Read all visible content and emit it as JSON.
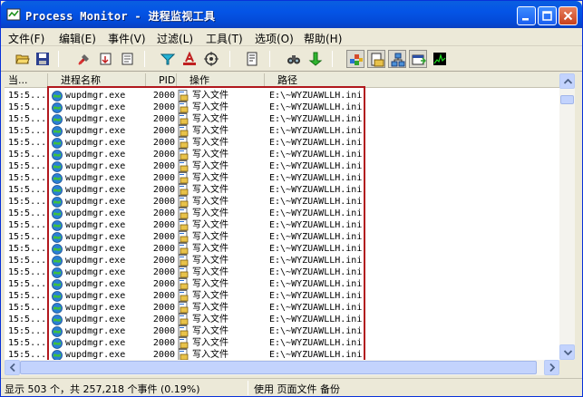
{
  "window": {
    "title": "Process Monitor - 进程监视工具"
  },
  "menu": [
    {
      "label": "文件(F)"
    },
    {
      "label": "编辑(E)"
    },
    {
      "label": "事件(V)"
    },
    {
      "label": "过滤(L)"
    },
    {
      "label": "工具(T)"
    },
    {
      "label": "选项(O)"
    },
    {
      "label": "帮助(H)"
    }
  ],
  "toolbar": [
    {
      "icon": "open-folder-icon"
    },
    {
      "icon": "save-icon"
    },
    {
      "icon": "clear-icon"
    },
    {
      "icon": "autoscroll-icon"
    },
    {
      "icon": "capture-icon"
    },
    {
      "icon": "filter-icon"
    },
    {
      "icon": "highlight-icon"
    },
    {
      "icon": "target-icon"
    },
    {
      "icon": "process-tree-icon"
    },
    {
      "icon": "find-icon"
    },
    {
      "icon": "jump-icon"
    },
    {
      "icon": "registry-icon"
    },
    {
      "icon": "file-system-icon"
    },
    {
      "icon": "network-icon"
    },
    {
      "icon": "process-thread-icon"
    },
    {
      "icon": "profiling-icon"
    }
  ],
  "columns": {
    "time": "当...",
    "process": "进程名称",
    "pid": "PID",
    "operation": "操作",
    "path": "路径"
  },
  "rows": [
    {
      "time": "15:5...",
      "process": "wupdmgr.exe",
      "pid": "2000",
      "operation": "写入文件",
      "path": "E:\\~WYZUAWLLH.ini"
    },
    {
      "time": "15:5...",
      "process": "wupdmgr.exe",
      "pid": "2000",
      "operation": "写入文件",
      "path": "E:\\~WYZUAWLLH.ini"
    },
    {
      "time": "15:5...",
      "process": "wupdmgr.exe",
      "pid": "2000",
      "operation": "写入文件",
      "path": "E:\\~WYZUAWLLH.ini"
    },
    {
      "time": "15:5...",
      "process": "wupdmgr.exe",
      "pid": "2000",
      "operation": "写入文件",
      "path": "E:\\~WYZUAWLLH.ini"
    },
    {
      "time": "15:5...",
      "process": "wupdmgr.exe",
      "pid": "2000",
      "operation": "写入文件",
      "path": "E:\\~WYZUAWLLH.ini"
    },
    {
      "time": "15:5...",
      "process": "wupdmgr.exe",
      "pid": "2000",
      "operation": "写入文件",
      "path": "E:\\~WYZUAWLLH.ini"
    },
    {
      "time": "15:5...",
      "process": "wupdmgr.exe",
      "pid": "2000",
      "operation": "写入文件",
      "path": "E:\\~WYZUAWLLH.ini"
    },
    {
      "time": "15:5...",
      "process": "wupdmgr.exe",
      "pid": "2000",
      "operation": "写入文件",
      "path": "E:\\~WYZUAWLLH.ini"
    },
    {
      "time": "15:5...",
      "process": "wupdmgr.exe",
      "pid": "2000",
      "operation": "写入文件",
      "path": "E:\\~WYZUAWLLH.ini"
    },
    {
      "time": "15:5...",
      "process": "wupdmgr.exe",
      "pid": "2000",
      "operation": "写入文件",
      "path": "E:\\~WYZUAWLLH.ini"
    },
    {
      "time": "15:5...",
      "process": "wupdmgr.exe",
      "pid": "2000",
      "operation": "写入文件",
      "path": "E:\\~WYZUAWLLH.ini"
    },
    {
      "time": "15:5...",
      "process": "wupdmgr.exe",
      "pid": "2000",
      "operation": "写入文件",
      "path": "E:\\~WYZUAWLLH.ini"
    },
    {
      "time": "15:5...",
      "process": "wupdmgr.exe",
      "pid": "2000",
      "operation": "写入文件",
      "path": "E:\\~WYZUAWLLH.ini"
    },
    {
      "time": "15:5...",
      "process": "wupdmgr.exe",
      "pid": "2000",
      "operation": "写入文件",
      "path": "E:\\~WYZUAWLLH.ini"
    },
    {
      "time": "15:5...",
      "process": "wupdmgr.exe",
      "pid": "2000",
      "operation": "写入文件",
      "path": "E:\\~WYZUAWLLH.ini"
    },
    {
      "time": "15:5...",
      "process": "wupdmgr.exe",
      "pid": "2000",
      "operation": "写入文件",
      "path": "E:\\~WYZUAWLLH.ini"
    },
    {
      "time": "15:5...",
      "process": "wupdmgr.exe",
      "pid": "2000",
      "operation": "写入文件",
      "path": "E:\\~WYZUAWLLH.ini"
    },
    {
      "time": "15:5...",
      "process": "wupdmgr.exe",
      "pid": "2000",
      "operation": "写入文件",
      "path": "E:\\~WYZUAWLLH.ini"
    },
    {
      "time": "15:5...",
      "process": "wupdmgr.exe",
      "pid": "2000",
      "operation": "写入文件",
      "path": "E:\\~WYZUAWLLH.ini"
    },
    {
      "time": "15:5...",
      "process": "wupdmgr.exe",
      "pid": "2000",
      "operation": "写入文件",
      "path": "E:\\~WYZUAWLLH.ini"
    },
    {
      "time": "15:5...",
      "process": "wupdmgr.exe",
      "pid": "2000",
      "operation": "写入文件",
      "path": "E:\\~WYZUAWLLH.ini"
    },
    {
      "time": "15:5...",
      "process": "wupdmgr.exe",
      "pid": "2000",
      "operation": "写入文件",
      "path": "E:\\~WYZUAWLLH.ini"
    },
    {
      "time": "15:5...",
      "process": "wupdmgr.exe",
      "pid": "2000",
      "operation": "写入文件",
      "path": "E:\\~WYZUAWLLH.ini"
    }
  ],
  "status": {
    "events": "显示 503 个，共 257,218 个事件 (0.19%)",
    "backing": "使用 页面文件 备份"
  },
  "colors": {
    "titlebar": "#0454e6",
    "highlight_border": "#b1181e",
    "chrome": "#ece9d8"
  }
}
